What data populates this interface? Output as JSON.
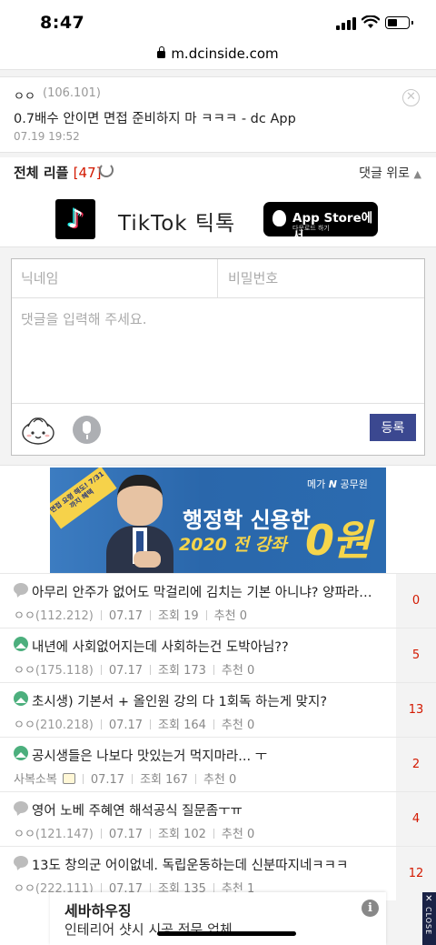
{
  "status": {
    "time": "8:47"
  },
  "browser": {
    "url": "m.dcinside.com"
  },
  "comment": {
    "nick": "ㅇㅇ",
    "ip": "(106.101)",
    "text": "0.7배수 안이면 면접 준비하지 마 ㅋㅋㅋ - dc App",
    "date": "07.19 19:52"
  },
  "reply_bar": {
    "title": "전체 리플",
    "count": "[47]",
    "goto_up": "댓글 위로"
  },
  "ad_tiktok": {
    "logo_glyph": "♪",
    "text": "TikTok 틱톡",
    "store_main": "App Store에서",
    "store_sub": "다운로드 하기"
  },
  "form": {
    "nick_placeholder": "닉네임",
    "pw_placeholder": "비밀번호",
    "memo_placeholder": "댓글을 입력해 주세요.",
    "submit": "등록"
  },
  "ad_banner": {
    "tag": "면접 요령 해도!\n7/31까지 혜택",
    "brand_a": "메가",
    "brand_b": "공무원",
    "line1": "행정학 신용한",
    "line2": "2020 전 강좌",
    "big": "0원"
  },
  "posts": [
    {
      "icon": "chat",
      "title": "아무리 안주가 없어도 막걸리에 김치는 기본 아니냐? 양파라도 씹어라",
      "writer": "ㅇㅇ",
      "ip": "(112.212)",
      "date": "07.17",
      "views": "조회 19",
      "recommend": "추천 0",
      "replies": "0"
    },
    {
      "icon": "image",
      "title": "내년에 사회없어지는데 사회하는건 도박아님??",
      "writer": "ㅇㅇ",
      "ip": "(175.118)",
      "date": "07.17",
      "views": "조회 173",
      "recommend": "추천 0",
      "replies": "5"
    },
    {
      "icon": "image",
      "title": "초시생) 기본서 + 올인원 강의 다 1회독 하는게 맞지?",
      "writer": "ㅇㅇ",
      "ip": "(210.218)",
      "date": "07.17",
      "views": "조회 164",
      "recommend": "추천 0",
      "replies": "13"
    },
    {
      "icon": "image",
      "title": "공시생들은 나보다 맛있는거 먹지마라... ㅜ",
      "writer": "사복소복",
      "ip": "",
      "date": "07.17",
      "views": "조회 167",
      "recommend": "추천 0",
      "replies": "2"
    },
    {
      "icon": "chat",
      "title": "영어 노베 주혜연 해석공식 질문좀ㅜㅠ",
      "writer": "ㅇㅇ",
      "ip": "(121.147)",
      "date": "07.17",
      "views": "조회 102",
      "recommend": "추천 0",
      "replies": "4"
    },
    {
      "icon": "chat",
      "title": "13도 창의군 어이없네. 독립운동하는데 신분따지네ㅋㅋㅋ",
      "writer": "ㅇㅇ",
      "ip": "(222.111)",
      "date": "07.17",
      "views": "조회 135",
      "recommend": "추천 1",
      "replies": "12"
    }
  ],
  "bottom_ad": {
    "brand": "세바하우징",
    "desc": "인테리어 샷시 시공 전문 업체",
    "info": "i",
    "close_x": "✕",
    "close": "CLOSE"
  },
  "colors": {
    "accent": "#d31900",
    "submit": "#3b4890",
    "banner": "#2e6fb2",
    "banner_yellow": "#f5d54b"
  }
}
